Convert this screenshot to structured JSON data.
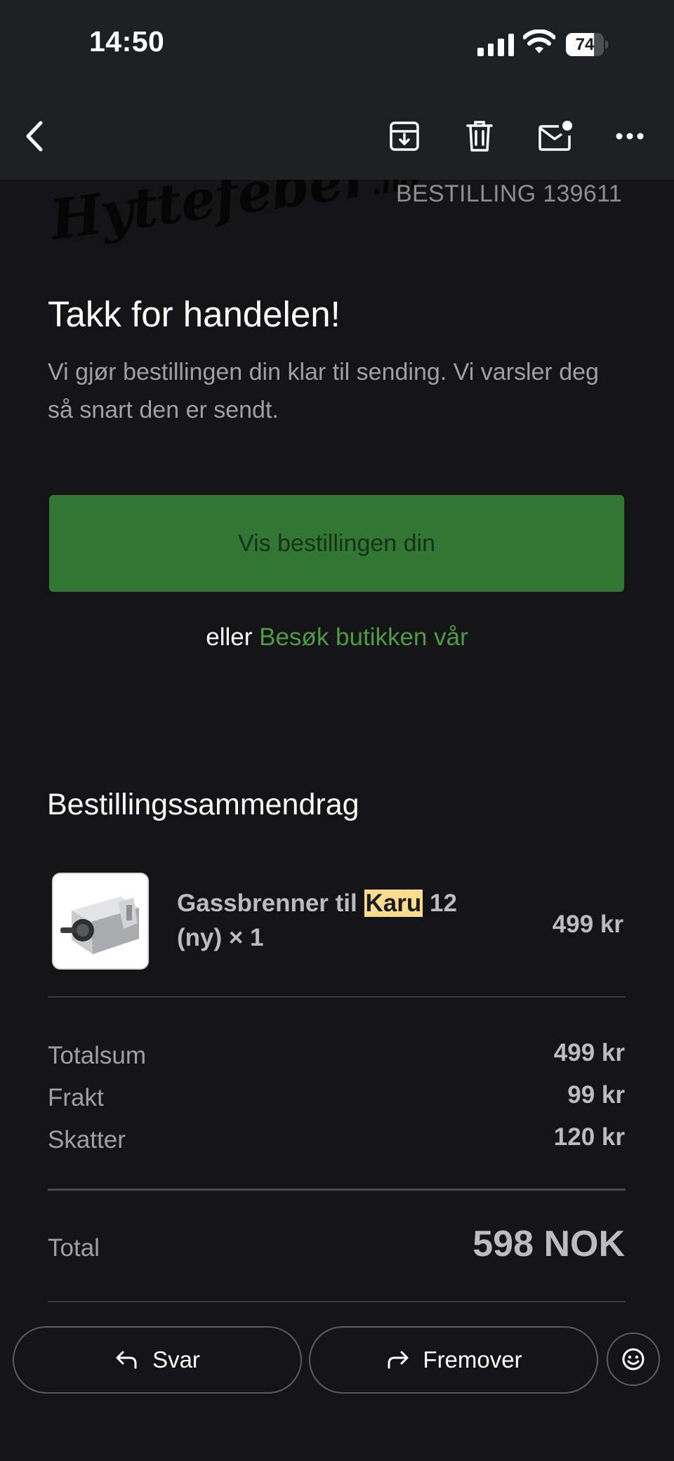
{
  "status_bar": {
    "time": "14:50",
    "battery_level": "74",
    "battery_fraction": 0.74
  },
  "toolbar": {
    "icons": [
      "chevron-left-icon",
      "archive-icon",
      "trash-icon",
      "mark-unread-icon",
      "more-icon"
    ]
  },
  "email": {
    "logo": {
      "text": "Hyttefeber",
      "suffix": ".no"
    },
    "order_number": "BESTILLING 139611",
    "heading": "Takk for handelen!",
    "lead": "Vi gjør bestillingen din klar til sending. Vi varsler deg så snart den er sendt.",
    "cta_label": "Vis bestillingen din",
    "or_text": "eller",
    "store_link": "Besøk butikken vår",
    "summary_heading": "Bestillingssammendrag",
    "item": {
      "name_before": "Gassbrenner til",
      "name_highlight": "Karu",
      "name_after": "12",
      "name_line2": "(ny) × 1",
      "price": "499 kr"
    },
    "totals": [
      {
        "label": "Totalsum",
        "value": "499 kr"
      },
      {
        "label": "Frakt",
        "value": "99 kr"
      },
      {
        "label": "Skatter",
        "value": "120 kr"
      }
    ],
    "grand_total": {
      "label": "Total",
      "value": "598 NOK"
    }
  },
  "actions": {
    "reply": "Svar",
    "forward": "Fremover"
  },
  "colors": {
    "accent_green": "#327633",
    "link_green": "#4f9a45",
    "highlight": "#fcdc8f"
  }
}
